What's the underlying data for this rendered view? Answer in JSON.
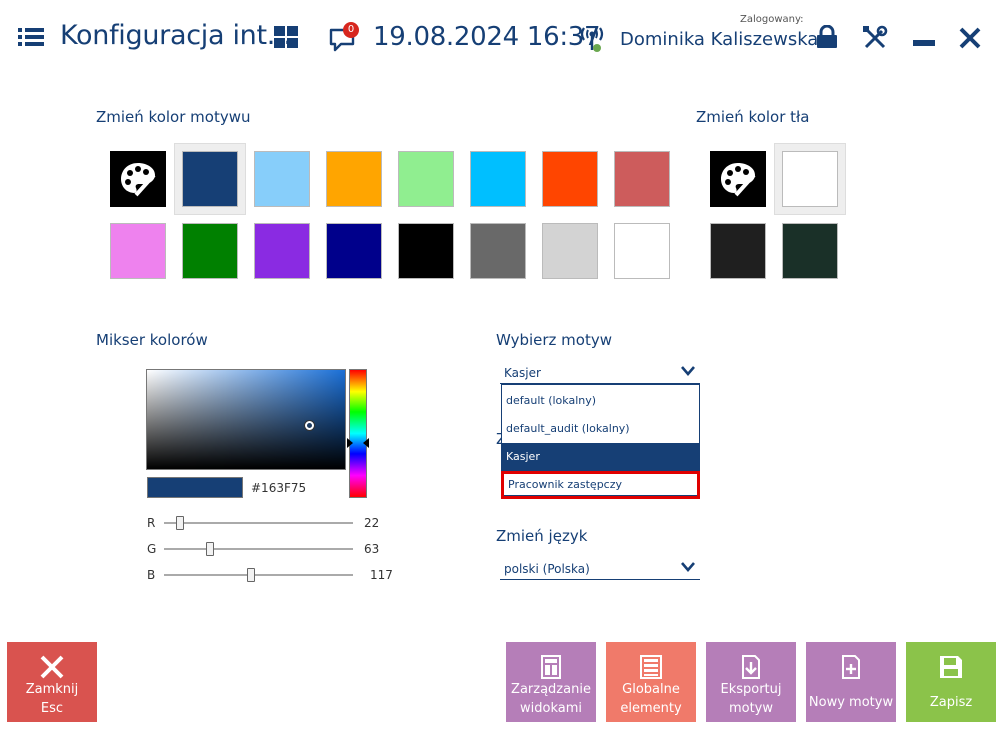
{
  "header": {
    "title": "Konfiguracja int...",
    "datetime": "19.08.2024 16:37",
    "notifications_count": "0",
    "logged_label": "Zalogowany:",
    "user_name": "Dominika Kaliszewska"
  },
  "theme_colors": {
    "title": "Zmień kolor motywu",
    "swatches_row1": [
      "palette",
      "#163F75",
      "#87CEFA",
      "#FFA500",
      "#90EE90",
      "#00BFFF",
      "#FF4500",
      "#CD5C5C"
    ],
    "swatches_row2": [
      "#EE82EE",
      "#008000",
      "#8A2BE2",
      "#00008B",
      "#000000",
      "#696969",
      "#D3D3D3",
      "#FFFFFF"
    ],
    "selected": "#163F75"
  },
  "background_colors": {
    "title": "Zmień kolor tła",
    "swatches_row1": [
      "palette",
      "#FFFFFF"
    ],
    "swatches_row2": [
      "#1F1F1F",
      "#1A3028"
    ],
    "selected": "#FFFFFF"
  },
  "mixer": {
    "title": "Mikser kolorów",
    "hex": "#163F75",
    "r_label": "R",
    "r_value": "22",
    "g_label": "G",
    "g_value": "63",
    "b_label": "B",
    "b_value": "117"
  },
  "theme_select": {
    "title": "Wybierz motyw",
    "value": "Kasjer",
    "options": [
      "default (lokalny)",
      "default_audit (lokalny)",
      "Kasjer",
      "Pracownik zastępczy"
    ],
    "hidden_label_fragment": "Z"
  },
  "language": {
    "title": "Zmień język",
    "value": "polski (Polska)"
  },
  "buttons": {
    "close": "Zamknij\nEsc",
    "manage_views": "Zarządzanie\nwidokami",
    "global_elements": "Globalne\nelementy",
    "export_theme": "Eksportuj\nmotyw",
    "new_theme": "Nowy motyw",
    "save": "Zapisz"
  },
  "colors": {
    "accent": "#163F75",
    "close_btn": "#D9534F",
    "purple_btn": "#B57EB8",
    "orange_btn": "#F07A6A",
    "green_btn": "#8BC34A",
    "highlight_border": "#E00000"
  }
}
